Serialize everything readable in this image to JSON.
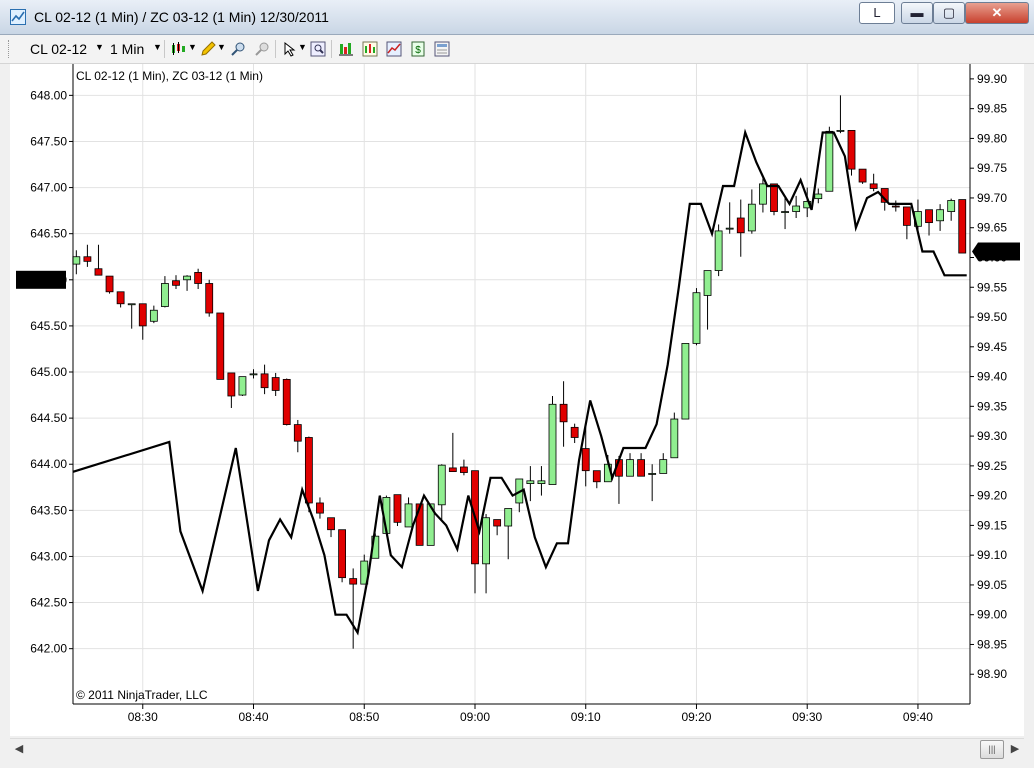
{
  "window": {
    "title": "CL 02-12 (1 Min) / ZC 03-12 (1 Min)  12/30/2011",
    "link_label": "L",
    "minimize_glyph": "▬",
    "maximize_glyph": "▢",
    "close_glyph": "✕"
  },
  "toolbar": {
    "instrument": "CL 02-12",
    "interval": "1 Min",
    "icons": [
      "chart-style-icon",
      "drawing-tool-icon",
      "zoom-in-icon",
      "zoom-out-icon",
      "cursor-icon",
      "magnifier-icon",
      "data-series-icon",
      "indicators-icon",
      "strategies-icon",
      "properties-icon",
      "chart-trader-icon"
    ]
  },
  "chart_data": {
    "type": "candlestick-with-line-overlay",
    "panel_label": "CL 02-12 (1 Min),  ZC 03-12 (1 Min)",
    "copyright": "© 2011 NinjaTrader, LLC",
    "x_ticks": [
      "08:30",
      "08:40",
      "08:50",
      "09:00",
      "09:10",
      "09:20",
      "09:30",
      "09:40"
    ],
    "x_tick_minutes": [
      510,
      520,
      530,
      540,
      550,
      560,
      570,
      580
    ],
    "x_range_minutes": [
      503.7,
      584.7
    ],
    "left_axis": {
      "ticks": [
        "648.00",
        "647.50",
        "647.00",
        "646.50",
        "646.00",
        "645.50",
        "645.00",
        "644.50",
        "644.00",
        "643.50",
        "643.00",
        "642.50",
        "642.00"
      ],
      "tick_values": [
        648.0,
        647.5,
        647.0,
        646.5,
        646.0,
        645.5,
        645.0,
        644.5,
        644.0,
        643.5,
        643.0,
        642.5,
        642.0
      ],
      "range": [
        641.4,
        648.34
      ],
      "marker": "646.00",
      "marker_value": 646.0
    },
    "right_axis": {
      "ticks": [
        "99.90",
        "99.85",
        "99.80",
        "99.75",
        "99.70",
        "99.65",
        "99.60",
        "99.55",
        "99.50",
        "99.45",
        "99.40",
        "99.35",
        "99.30",
        "99.25",
        "99.20",
        "99.15",
        "99.10",
        "99.05",
        "99.00",
        "98.95",
        "98.90"
      ],
      "tick_values": [
        99.9,
        99.85,
        99.8,
        99.75,
        99.7,
        99.65,
        99.6,
        99.55,
        99.5,
        99.45,
        99.4,
        99.35,
        99.3,
        99.25,
        99.2,
        99.15,
        99.1,
        99.05,
        99.0,
        98.95,
        98.9
      ],
      "range": [
        98.85,
        99.925
      ],
      "marker": "99.61",
      "marker_value": 99.61
    },
    "candles": [
      {
        "m": 504,
        "o": 646.17,
        "h": 646.32,
        "l": 646.06,
        "c": 646.25
      },
      {
        "m": 505,
        "o": 646.25,
        "h": 646.38,
        "l": 646.14,
        "c": 646.2
      },
      {
        "m": 506,
        "o": 646.12,
        "h": 646.38,
        "l": 646.05,
        "c": 646.05
      },
      {
        "m": 507,
        "o": 646.04,
        "h": 646.04,
        "l": 645.85,
        "c": 645.87
      },
      {
        "m": 508,
        "o": 645.87,
        "h": 645.87,
        "l": 645.7,
        "c": 645.74
      },
      {
        "m": 509,
        "o": 645.74,
        "h": 645.74,
        "l": 645.47,
        "c": 645.74
      },
      {
        "m": 510,
        "o": 645.74,
        "h": 645.74,
        "l": 645.35,
        "c": 645.5
      },
      {
        "m": 511,
        "o": 645.55,
        "h": 645.72,
        "l": 645.53,
        "c": 645.67
      },
      {
        "m": 512,
        "o": 645.71,
        "h": 646.04,
        "l": 645.7,
        "c": 645.96
      },
      {
        "m": 513,
        "o": 645.99,
        "h": 646.05,
        "l": 645.9,
        "c": 645.94
      },
      {
        "m": 514,
        "o": 646.0,
        "h": 646.05,
        "l": 645.88,
        "c": 646.04
      },
      {
        "m": 515,
        "o": 646.08,
        "h": 646.12,
        "l": 645.9,
        "c": 645.96
      },
      {
        "m": 516,
        "o": 645.96,
        "h": 646.0,
        "l": 645.6,
        "c": 645.64
      },
      {
        "m": 517,
        "o": 645.64,
        "h": 645.64,
        "l": 644.94,
        "c": 644.92
      },
      {
        "m": 518,
        "o": 644.99,
        "h": 644.99,
        "l": 644.61,
        "c": 644.74
      },
      {
        "m": 519,
        "o": 644.75,
        "h": 644.95,
        "l": 644.74,
        "c": 644.95
      },
      {
        "m": 520,
        "o": 644.98,
        "h": 645.03,
        "l": 644.93,
        "c": 644.98
      },
      {
        "m": 521,
        "o": 644.98,
        "h": 645.08,
        "l": 644.76,
        "c": 644.83
      },
      {
        "m": 522,
        "o": 644.94,
        "h": 644.99,
        "l": 644.74,
        "c": 644.8
      },
      {
        "m": 523,
        "o": 644.92,
        "h": 644.93,
        "l": 644.42,
        "c": 644.43
      },
      {
        "m": 524,
        "o": 644.43,
        "h": 644.48,
        "l": 644.13,
        "c": 644.25
      },
      {
        "m": 525,
        "o": 644.29,
        "h": 644.3,
        "l": 643.48,
        "c": 643.58
      },
      {
        "m": 526,
        "o": 643.58,
        "h": 643.64,
        "l": 643.41,
        "c": 643.47
      },
      {
        "m": 527,
        "o": 643.42,
        "h": 643.42,
        "l": 643.21,
        "c": 643.29
      },
      {
        "m": 528,
        "o": 643.29,
        "h": 643.29,
        "l": 642.72,
        "c": 642.77
      },
      {
        "m": 529,
        "o": 642.76,
        "h": 642.87,
        "l": 642.0,
        "c": 642.7
      },
      {
        "m": 530,
        "o": 642.7,
        "h": 643.02,
        "l": 642.7,
        "c": 642.95
      },
      {
        "m": 531,
        "o": 642.98,
        "h": 643.25,
        "l": 642.98,
        "c": 643.22
      },
      {
        "m": 532,
        "o": 643.25,
        "h": 643.66,
        "l": 643.25,
        "c": 643.64
      },
      {
        "m": 533,
        "o": 643.67,
        "h": 643.67,
        "l": 643.33,
        "c": 643.37
      },
      {
        "m": 534,
        "o": 643.32,
        "h": 643.64,
        "l": 643.32,
        "c": 643.57
      },
      {
        "m": 535,
        "o": 643.57,
        "h": 643.57,
        "l": 643.12,
        "c": 643.12
      },
      {
        "m": 536,
        "o": 643.12,
        "h": 643.57,
        "l": 643.12,
        "c": 643.57
      },
      {
        "m": 537,
        "o": 643.56,
        "h": 644.0,
        "l": 643.4,
        "c": 643.99
      },
      {
        "m": 538,
        "o": 643.96,
        "h": 644.34,
        "l": 643.95,
        "c": 643.92
      },
      {
        "m": 539,
        "o": 643.97,
        "h": 644.05,
        "l": 643.88,
        "c": 643.91
      },
      {
        "m": 540,
        "o": 643.93,
        "h": 643.93,
        "l": 642.6,
        "c": 642.92
      },
      {
        "m": 541,
        "o": 642.92,
        "h": 643.46,
        "l": 642.6,
        "c": 643.42
      },
      {
        "m": 542,
        "o": 643.4,
        "h": 643.4,
        "l": 643.23,
        "c": 643.33
      },
      {
        "m": 543,
        "o": 643.33,
        "h": 643.52,
        "l": 642.97,
        "c": 643.52
      },
      {
        "m": 544,
        "o": 643.58,
        "h": 643.82,
        "l": 643.48,
        "c": 643.84
      },
      {
        "m": 545,
        "o": 643.79,
        "h": 643.98,
        "l": 643.6,
        "c": 643.82
      },
      {
        "m": 546,
        "o": 643.79,
        "h": 643.98,
        "l": 643.66,
        "c": 643.82
      },
      {
        "m": 547,
        "o": 643.78,
        "h": 644.74,
        "l": 643.78,
        "c": 644.65
      },
      {
        "m": 548,
        "o": 644.65,
        "h": 644.9,
        "l": 644.19,
        "c": 644.46
      },
      {
        "m": 549,
        "o": 644.4,
        "h": 644.44,
        "l": 644.23,
        "c": 644.29
      },
      {
        "m": 550,
        "o": 644.17,
        "h": 644.4,
        "l": 643.76,
        "c": 643.93
      },
      {
        "m": 551,
        "o": 643.93,
        "h": 643.93,
        "l": 643.74,
        "c": 643.81
      },
      {
        "m": 552,
        "o": 643.81,
        "h": 644.1,
        "l": 643.81,
        "c": 644.0
      },
      {
        "m": 553,
        "o": 644.05,
        "h": 644.09,
        "l": 643.57,
        "c": 643.87
      },
      {
        "m": 554,
        "o": 643.87,
        "h": 644.12,
        "l": 643.87,
        "c": 644.05
      },
      {
        "m": 555,
        "o": 644.05,
        "h": 644.12,
        "l": 643.87,
        "c": 643.87
      },
      {
        "m": 556,
        "o": 643.9,
        "h": 644.0,
        "l": 643.6,
        "c": 643.9
      },
      {
        "m": 557,
        "o": 643.9,
        "h": 644.12,
        "l": 643.9,
        "c": 644.05
      },
      {
        "m": 558,
        "o": 644.07,
        "h": 644.56,
        "l": 644.07,
        "c": 644.49
      },
      {
        "m": 559,
        "o": 644.49,
        "h": 645.31,
        "l": 644.49,
        "c": 645.31
      },
      {
        "m": 560,
        "o": 645.31,
        "h": 645.91,
        "l": 645.29,
        "c": 645.86
      },
      {
        "m": 561,
        "o": 645.83,
        "h": 646.1,
        "l": 645.46,
        "c": 646.1
      },
      {
        "m": 562,
        "o": 646.1,
        "h": 646.6,
        "l": 646.04,
        "c": 646.53
      },
      {
        "m": 563,
        "o": 646.55,
        "h": 646.84,
        "l": 646.5,
        "c": 646.56
      },
      {
        "m": 564,
        "o": 646.67,
        "h": 646.87,
        "l": 646.25,
        "c": 646.51
      },
      {
        "m": 565,
        "o": 646.53,
        "h": 646.98,
        "l": 646.5,
        "c": 646.82
      },
      {
        "m": 566,
        "o": 646.82,
        "h": 647.1,
        "l": 646.73,
        "c": 647.04
      },
      {
        "m": 567,
        "o": 647.04,
        "h": 647.04,
        "l": 646.7,
        "c": 646.74
      },
      {
        "m": 568,
        "o": 646.74,
        "h": 646.9,
        "l": 646.55,
        "c": 646.74
      },
      {
        "m": 569,
        "o": 646.74,
        "h": 646.91,
        "l": 646.67,
        "c": 646.8
      },
      {
        "m": 570,
        "o": 646.78,
        "h": 647.0,
        "l": 646.68,
        "c": 646.85
      },
      {
        "m": 571,
        "o": 646.88,
        "h": 646.99,
        "l": 646.83,
        "c": 646.93
      },
      {
        "m": 572,
        "o": 646.96,
        "h": 647.66,
        "l": 646.96,
        "c": 647.61
      },
      {
        "m": 573,
        "o": 647.61,
        "h": 648.0,
        "l": 647.59,
        "c": 647.62
      },
      {
        "m": 574,
        "o": 647.62,
        "h": 647.62,
        "l": 647.13,
        "c": 647.2
      },
      {
        "m": 575,
        "o": 647.2,
        "h": 647.2,
        "l": 647.04,
        "c": 647.06
      },
      {
        "m": 576,
        "o": 647.04,
        "h": 647.15,
        "l": 646.96,
        "c": 646.99
      },
      {
        "m": 577,
        "o": 646.99,
        "h": 646.99,
        "l": 646.75,
        "c": 646.84
      },
      {
        "m": 578,
        "o": 646.8,
        "h": 646.86,
        "l": 646.74,
        "c": 646.79
      },
      {
        "m": 579,
        "o": 646.79,
        "h": 646.79,
        "l": 646.44,
        "c": 646.59
      },
      {
        "m": 580,
        "o": 646.58,
        "h": 646.87,
        "l": 646.48,
        "c": 646.74
      },
      {
        "m": 581,
        "o": 646.76,
        "h": 646.76,
        "l": 646.48,
        "c": 646.62
      },
      {
        "m": 582,
        "o": 646.64,
        "h": 646.82,
        "l": 646.53,
        "c": 646.76
      },
      {
        "m": 583,
        "o": 646.74,
        "h": 646.88,
        "l": 646.64,
        "c": 646.86
      },
      {
        "m": 584,
        "o": 646.87,
        "h": 646.87,
        "l": 646.29,
        "c": 646.29
      }
    ],
    "overlay_line": {
      "values": [
        [
          503.7,
          99.24
        ],
        [
          512.4,
          99.29
        ],
        [
          513.4,
          99.14
        ],
        [
          515.4,
          99.04
        ],
        [
          518.4,
          99.28
        ],
        [
          520.4,
          99.04
        ],
        [
          521.4,
          99.125
        ],
        [
          522.4,
          99.16
        ],
        [
          523.4,
          99.13
        ],
        [
          524.4,
          99.21
        ],
        [
          525.4,
          99.16
        ],
        [
          526.4,
          99.1
        ],
        [
          527.4,
          99.0
        ],
        [
          528.4,
          99.0
        ],
        [
          529.4,
          98.97
        ],
        [
          530.4,
          99.07
        ],
        [
          531.4,
          99.2
        ],
        [
          532.4,
          99.1
        ],
        [
          533.4,
          99.08
        ],
        [
          534.4,
          99.15
        ],
        [
          535.4,
          99.2
        ],
        [
          536.4,
          99.17
        ],
        [
          537.4,
          99.15
        ],
        [
          538.4,
          99.11
        ],
        [
          539.4,
          99.2
        ],
        [
          540.4,
          99.14
        ],
        [
          541.4,
          99.23
        ],
        [
          542.4,
          99.23
        ],
        [
          543.4,
          99.2
        ],
        [
          544.4,
          99.21
        ],
        [
          545.4,
          99.13
        ],
        [
          546.4,
          99.08
        ],
        [
          547.4,
          99.12
        ],
        [
          548.4,
          99.12
        ],
        [
          549.4,
          99.26
        ],
        [
          550.4,
          99.36
        ],
        [
          551.4,
          99.3
        ],
        [
          552.4,
          99.23
        ],
        [
          553.4,
          99.28
        ],
        [
          554.4,
          99.28
        ],
        [
          555.4,
          99.28
        ],
        [
          556.4,
          99.32
        ],
        [
          557.4,
          99.42
        ],
        [
          558.4,
          99.55
        ],
        [
          559.4,
          99.69
        ],
        [
          560.4,
          99.69
        ],
        [
          561.4,
          99.64
        ],
        [
          562.4,
          99.72
        ],
        [
          563.4,
          99.72
        ],
        [
          564.4,
          99.81
        ],
        [
          565.4,
          99.76
        ],
        [
          566.4,
          99.72
        ],
        [
          567.4,
          99.72
        ],
        [
          568.4,
          99.69
        ],
        [
          569.4,
          99.73
        ],
        [
          570.4,
          99.68
        ],
        [
          571.4,
          99.81
        ],
        [
          572.4,
          99.81
        ],
        [
          573.4,
          99.77
        ],
        [
          574.4,
          99.65
        ],
        [
          575.4,
          99.7
        ],
        [
          576.4,
          99.71
        ],
        [
          577.4,
          99.69
        ],
        [
          578.4,
          99.69
        ],
        [
          579.4,
          99.69
        ],
        [
          580.4,
          99.61
        ],
        [
          581.4,
          99.61
        ],
        [
          582.4,
          99.57
        ],
        [
          584.4,
          99.57
        ]
      ]
    },
    "colors": {
      "up_body": "#90ee90",
      "down_body": "#e00000",
      "wick": "#000000",
      "line": "#000000",
      "grid": "#e2e2e2",
      "marker_bg": "#000000",
      "marker_text": "#ffffff"
    },
    "grid": true
  },
  "scrollbar": {
    "left_glyph": "◀",
    "right_glyph": "▶",
    "thumb_glyph": "|||"
  }
}
